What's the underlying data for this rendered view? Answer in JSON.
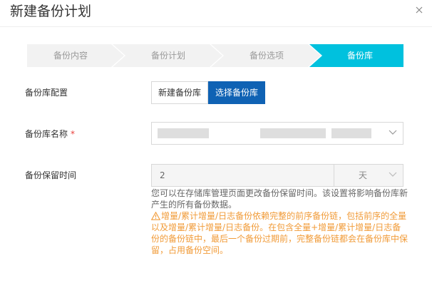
{
  "dialog": {
    "title": "新建备份计划"
  },
  "steps": [
    {
      "label": "备份内容",
      "active": false
    },
    {
      "label": "备份计划",
      "active": false
    },
    {
      "label": "备份选项",
      "active": false
    },
    {
      "label": "备份库",
      "active": true
    }
  ],
  "form": {
    "repo_config": {
      "label": "备份库配置",
      "options": [
        "新建备份库",
        "选择备份库"
      ],
      "selected": "选择备份库"
    },
    "repo_name": {
      "label": "备份库名称",
      "required_mark": "*",
      "value": ""
    },
    "retention": {
      "label": "备份保留时间",
      "value": "2",
      "unit": "天",
      "hint": "您可以在存储库管理页面更改备份保留时间。该设置将影响备份库新产生的所有备份数据。",
      "warning": "增量/累计增量/日志备份依赖完整的前序备份链，包括前序的全量以及增量/累计增量/日志备份。在包含全量+增量/累计增量/日志备份的备份链中，最后一个备份过期前，完整备份链都会在备份库中保留，占用备份空间。"
    }
  },
  "colors": {
    "step_inactive": "#f2f2f2",
    "step_active": "#00c1de",
    "primary": "#0f62b4",
    "warning": "#f19b38",
    "required": "#e9413d"
  },
  "icons": [
    "close-icon",
    "chevron-down-icon",
    "warning-triangle-icon"
  ]
}
